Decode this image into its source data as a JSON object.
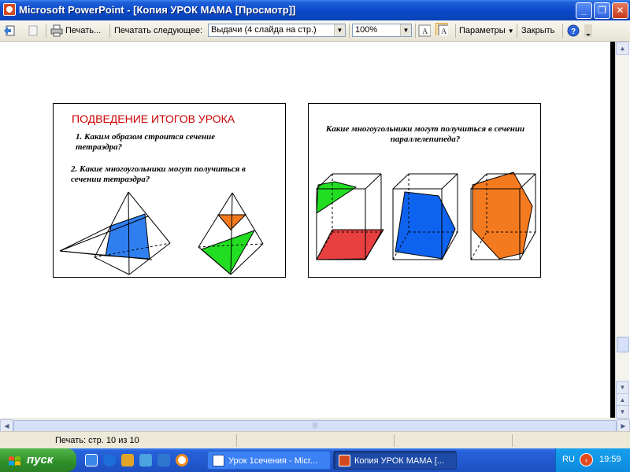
{
  "window": {
    "title": "Microsoft PowerPoint - [Копия УРОК МАМА [Просмотр]]",
    "minimize": "_",
    "restore": "❐",
    "close": "✕"
  },
  "toolbar": {
    "print_label": "Печать...",
    "print_next_label": "Печатать следующее:",
    "print_what_value": "Выдачи (4 слайда на стр.)",
    "zoom_value": "100%",
    "options_label": "Параметры",
    "close_label": "Закрыть"
  },
  "status": {
    "page_text": "Печать: стр. 10 из 10"
  },
  "slides": {
    "slide1": {
      "title": "ПОДВЕДЕНИЕ ИТОГОВ УРОКА",
      "q1": "1. Каким образом строится   сечение тетраэдра?",
      "q2": "2. Какие многоугольники могут получиться в  сечении тетраэдра?"
    },
    "slide2": {
      "question": "Какие многоугольники могут получиться в  сечении параллелепипеда?"
    }
  },
  "colors": {
    "blue_section": "#2f7ff0",
    "green_section": "#22dd22",
    "orange_section": "#f47a20",
    "red_section": "#e84040"
  },
  "taskbar": {
    "start_label": "пуск",
    "task1": "Урок 1сечения - Micr...",
    "task2": "Копия УРОК МАМА [...",
    "lang": "RU",
    "clock": "19:59"
  }
}
